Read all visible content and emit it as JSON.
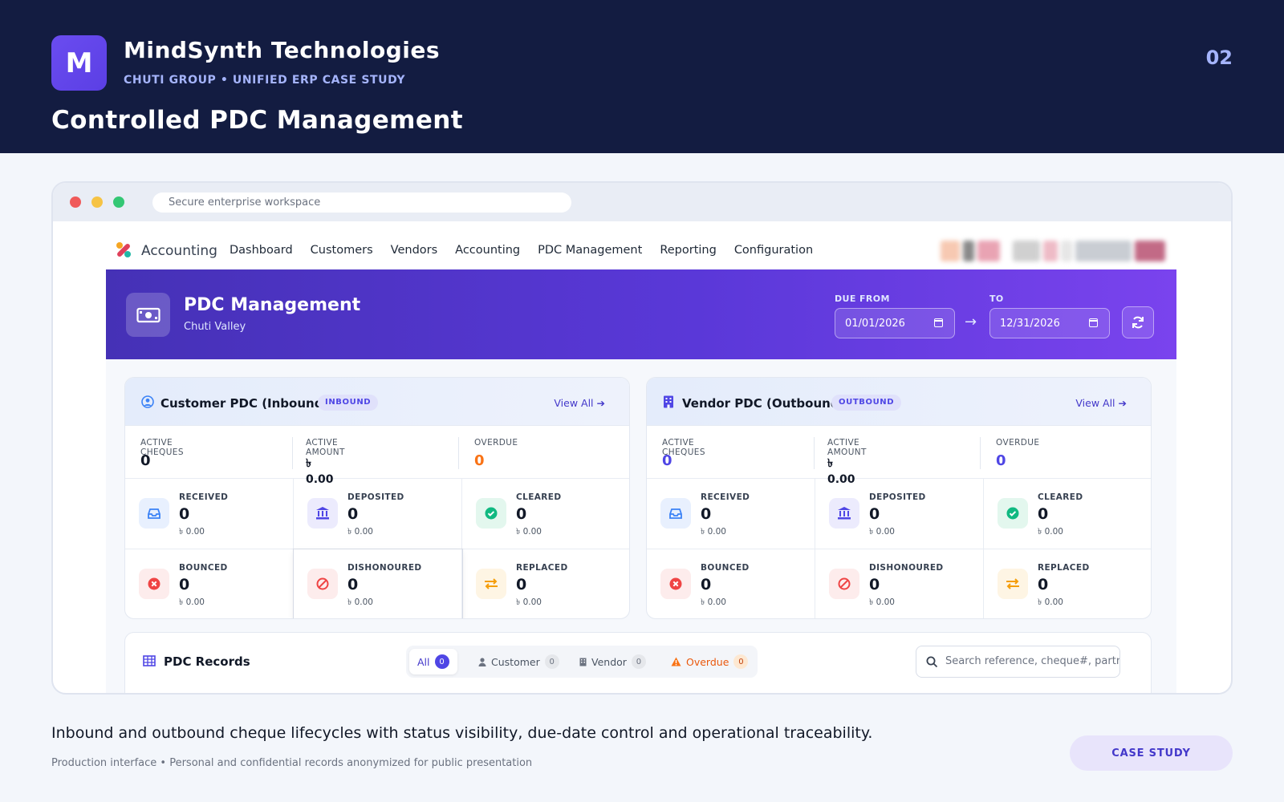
{
  "brand": {
    "logo_letter": "M",
    "name": "MindSynth Technologies",
    "subtitle": "CHUTI GROUP  •  UNIFIED ERP CASE STUDY",
    "slide_number": "02",
    "headline": "Controlled PDC Management"
  },
  "browser": {
    "url_placeholder": "Secure enterprise workspace"
  },
  "app": {
    "name": "Accounting",
    "menu": [
      "Dashboard",
      "Customers",
      "Vendors",
      "Accounting",
      "PDC Management",
      "Reporting",
      "Configuration"
    ]
  },
  "banner": {
    "title": "PDC Management",
    "subtitle": "Chuti Valley",
    "due_from_label": "DUE FROM",
    "to_label": "TO",
    "date_from": "01/01/2026",
    "date_to": "12/31/2026",
    "arrow": "→"
  },
  "customer_panel": {
    "title": "Customer PDC (Inbound)",
    "tag": "INBOUND",
    "view_all": "View All",
    "summary": {
      "active_cheques_label": "ACTIVE CHEQUES",
      "active_cheques": "0",
      "active_amount_label": "ACTIVE AMOUNT",
      "active_amount": "৳ 0.00",
      "overdue_label": "OVERDUE",
      "overdue": "0"
    },
    "statuses": [
      {
        "label": "RECEIVED",
        "count": "0",
        "amount": "৳ 0.00"
      },
      {
        "label": "DEPOSITED",
        "count": "0",
        "amount": "৳ 0.00"
      },
      {
        "label": "CLEARED",
        "count": "0",
        "amount": "৳ 0.00"
      },
      {
        "label": "BOUNCED",
        "count": "0",
        "amount": "৳ 0.00"
      },
      {
        "label": "DISHONOURED",
        "count": "0",
        "amount": "৳ 0.00"
      },
      {
        "label": "REPLACED",
        "count": "0",
        "amount": "৳ 0.00"
      }
    ]
  },
  "vendor_panel": {
    "title": "Vendor PDC (Outbound)",
    "tag": "OUTBOUND",
    "view_all": "View All",
    "summary": {
      "active_cheques_label": "ACTIVE CHEQUES",
      "active_cheques": "0",
      "active_amount_label": "ACTIVE AMOUNT",
      "active_amount": "৳ 0.00",
      "overdue_label": "OVERDUE",
      "overdue": "0"
    },
    "statuses": [
      {
        "label": "RECEIVED",
        "count": "0",
        "amount": "৳ 0.00"
      },
      {
        "label": "DEPOSITED",
        "count": "0",
        "amount": "৳ 0.00"
      },
      {
        "label": "CLEARED",
        "count": "0",
        "amount": "৳ 0.00"
      },
      {
        "label": "BOUNCED",
        "count": "0",
        "amount": "৳ 0.00"
      },
      {
        "label": "DISHONOURED",
        "count": "0",
        "amount": "৳ 0.00"
      },
      {
        "label": "REPLACED",
        "count": "0",
        "amount": "৳ 0.00"
      }
    ]
  },
  "records": {
    "title": "PDC Records",
    "filters": [
      {
        "label": "All",
        "count": "0"
      },
      {
        "label": "Customer",
        "count": "0"
      },
      {
        "label": "Vendor",
        "count": "0"
      },
      {
        "label": "Overdue",
        "count": "0"
      }
    ],
    "search_placeholder": "Search reference, cheque#, partner..."
  },
  "footer": {
    "caption": "Inbound and outbound cheque lifecycles with status visibility, due-date control and operational traceability.",
    "note": "Production interface • Personal and confidential records anonymized for public presentation",
    "button": "CASE STUDY"
  },
  "colors": {
    "hero_bg": "#131c41",
    "accent": "#4f46e5",
    "banner_start": "#4531b6",
    "banner_end": "#7a43ee",
    "overdue_orange": "#f97316",
    "vendor_count_purple": "#4f46e5"
  }
}
